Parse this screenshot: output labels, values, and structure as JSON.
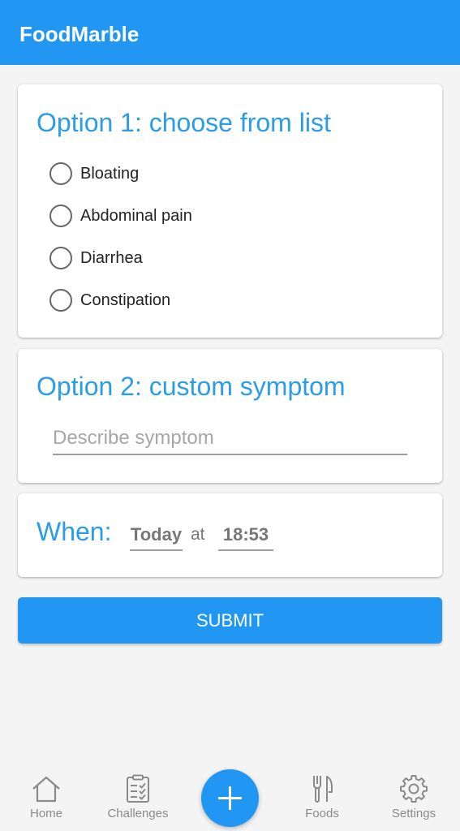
{
  "app": {
    "title": "FoodMarble"
  },
  "option1": {
    "heading": "Option 1: choose from list",
    "items": [
      {
        "label": "Bloating"
      },
      {
        "label": "Abdominal pain"
      },
      {
        "label": "Diarrhea"
      },
      {
        "label": "Constipation"
      }
    ]
  },
  "option2": {
    "heading": "Option 2: custom symptom",
    "placeholder": "Describe symptom",
    "value": ""
  },
  "when": {
    "label": "When:",
    "date": "Today",
    "at": "at",
    "time": "18:53"
  },
  "submit": {
    "label": "SUBMIT"
  },
  "nav": {
    "items": [
      {
        "label": "Home",
        "icon": "home-icon"
      },
      {
        "label": "Challenges",
        "icon": "clipboard-icon"
      },
      {
        "label": "Foods",
        "icon": "fork-knife-icon"
      },
      {
        "label": "Settings",
        "icon": "gear-icon"
      }
    ],
    "fab_icon": "plus-icon"
  },
  "colors": {
    "primary": "#2196f3",
    "heading": "#2b9de6",
    "nav_text": "#8a8a8a"
  }
}
